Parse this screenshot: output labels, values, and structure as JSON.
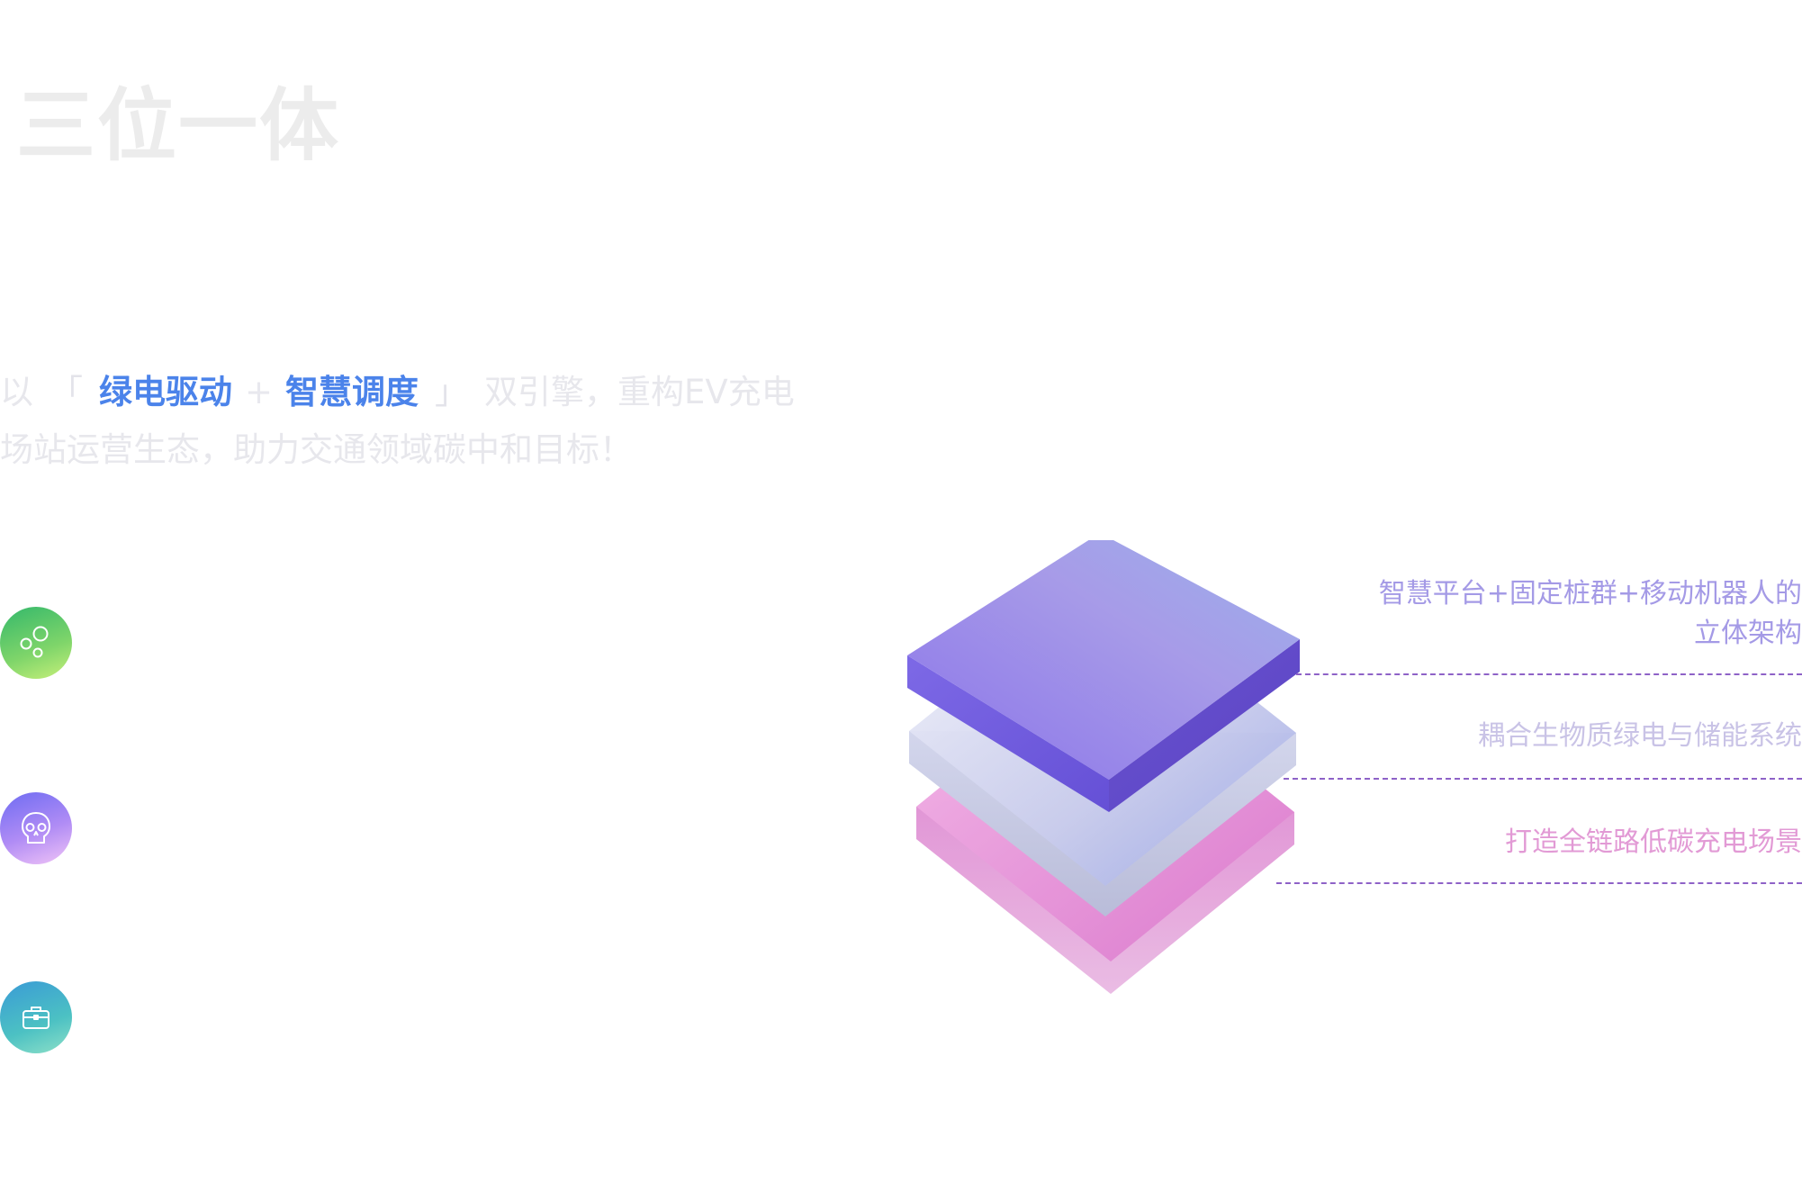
{
  "page": {
    "title": "三位一体"
  },
  "intro": {
    "prefix": "以",
    "bracket_open": "「",
    "highlight_1": "绿电驱动",
    "plus": "+",
    "highlight_2": "智慧调度",
    "bracket_close": "」",
    "line1_suffix": "双引擎，重构EV充电",
    "line2": "场站运营生态，助力交通领域碳中和目标！"
  },
  "features": [
    {
      "icon": "bubbles-icon",
      "color": "#4cbf6b"
    },
    {
      "icon": "skull-icon",
      "color": "#8f7cf4"
    },
    {
      "icon": "briefcase-icon",
      "color": "#45b7c6"
    }
  ],
  "layers": [
    {
      "label": "智慧平台+固定桩群+移动机器人的",
      "label_line2": "立体架构",
      "color": "#a49ae6"
    },
    {
      "label": "耦合生物质绿电与储能系统",
      "color": "#c9c3e6"
    },
    {
      "label": "打造全链路低碳充电场景",
      "color": "#e29ad5"
    }
  ],
  "colors": {
    "accent": "#4b83ea",
    "title": "#ececec",
    "rule": "#8e62c7"
  }
}
